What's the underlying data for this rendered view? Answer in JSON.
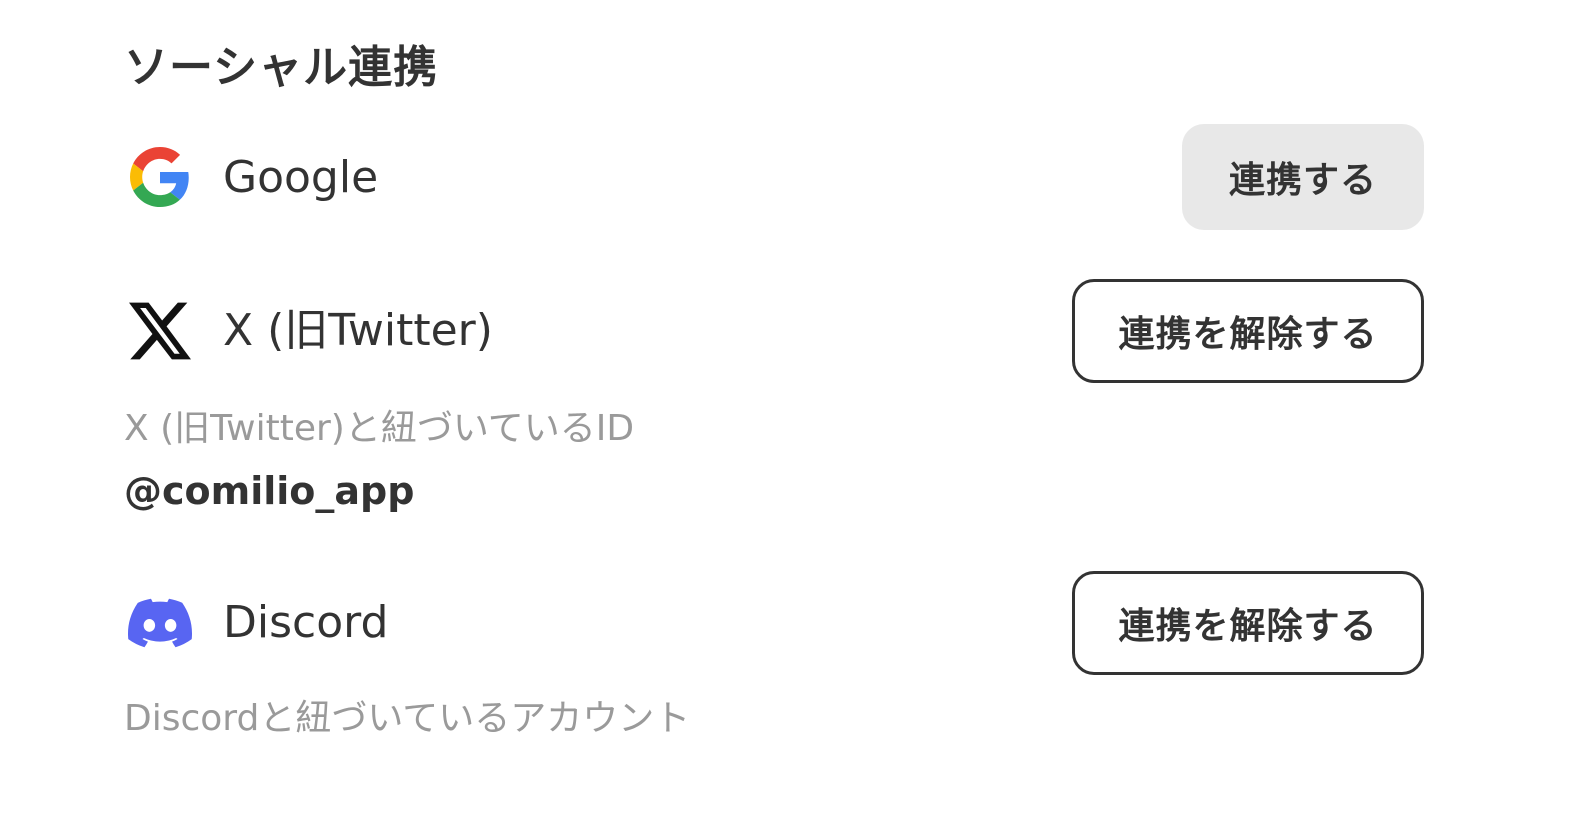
{
  "section": {
    "title": "ソーシャル連携"
  },
  "providers": [
    {
      "name": "Google",
      "icon": "google-icon",
      "action_label": "連携する"
    },
    {
      "name": "X (旧Twitter)",
      "icon": "x-icon",
      "action_label": "連携を解除する",
      "linked_caption": "X (旧Twitter)と紐づいているID",
      "linked_value": "@comilio_app"
    },
    {
      "name": "Discord",
      "icon": "discord-icon",
      "action_label": "連携を解除する",
      "linked_caption": "Discordと紐づいているアカウント"
    }
  ],
  "colors": {
    "text": "#333333",
    "muted": "#9a9a9a",
    "connect_button_bg": "#e8e8e8",
    "discord": "#5865F2",
    "google_blue": "#4285F4",
    "google_red": "#EA4335",
    "google_yellow": "#FBBC05",
    "google_green": "#34A853"
  }
}
